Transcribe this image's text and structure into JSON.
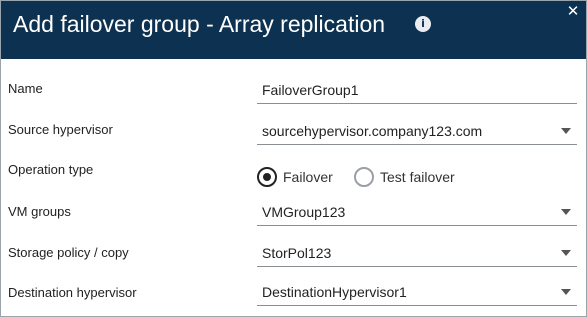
{
  "dialog": {
    "title": "Add failover group - Array replication",
    "info_icon": "info-icon",
    "close_icon": "close-icon",
    "info_glyph": "i",
    "close_glyph": "✕",
    "colors": {
      "header": "#0d3150",
      "title_text": "#ffffff"
    }
  },
  "form": {
    "name": {
      "label": "Name",
      "value": "FailoverGroup1"
    },
    "source_hypervisor": {
      "label": "Source hypervisor",
      "value": "sourcehypervisor.company123.com"
    },
    "operation_type": {
      "label": "Operation type",
      "options": [
        {
          "label": "Failover",
          "selected": true
        },
        {
          "label": "Test failover",
          "selected": false
        }
      ]
    },
    "vm_groups": {
      "label": "VM groups",
      "value": "VMGroup123"
    },
    "storage_policy": {
      "label": "Storage policy / copy",
      "value": "StorPol123"
    },
    "destination_hypervisor": {
      "label": "Destination hypervisor",
      "value": "DestinationHypervisor1"
    }
  }
}
